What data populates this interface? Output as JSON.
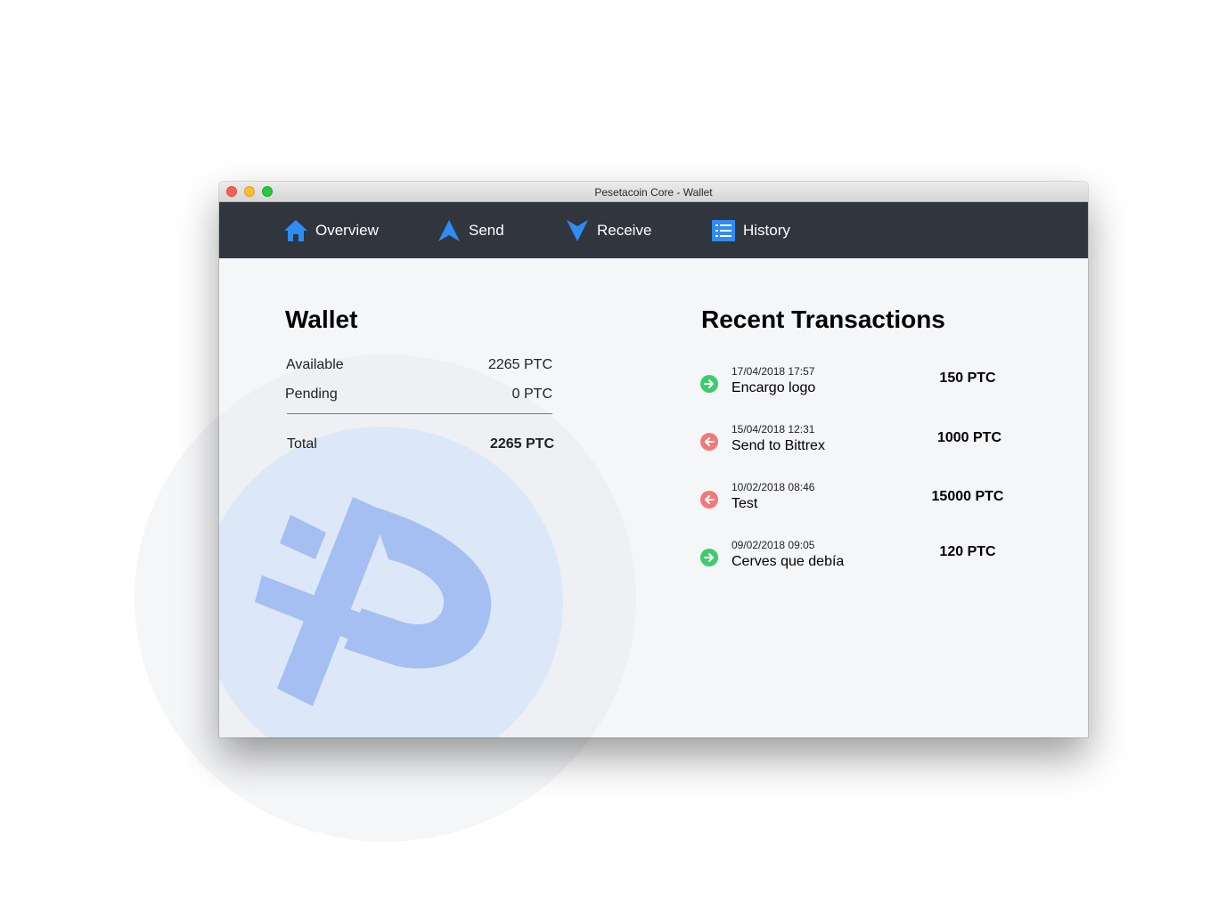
{
  "window": {
    "title": "Pesetacoin Core - Wallet"
  },
  "nav": {
    "items": [
      {
        "label": "Overview",
        "icon": "home-icon"
      },
      {
        "label": "Send",
        "icon": "send-arrow-icon"
      },
      {
        "label": "Receive",
        "icon": "receive-arrow-icon"
      },
      {
        "label": "History",
        "icon": "list-icon"
      }
    ],
    "accent_color": "#2f8cf5",
    "bar_color": "#30353e"
  },
  "wallet": {
    "title": "Wallet",
    "available_label": "Available",
    "available_value": "2265 PTC",
    "pending_label": "Pending",
    "pending_value": "0 PTC",
    "total_label": "Total",
    "total_value": "2265 PTC"
  },
  "transactions": {
    "title": "Recent Transactions",
    "items": [
      {
        "date": "17/04/2018 17:57",
        "label": "Encargo logo",
        "amount": "150 PTC",
        "direction": "incoming",
        "color": "#3ecb6f"
      },
      {
        "date": "15/04/2018 12:31",
        "label": "Send to Bittrex",
        "amount": "1000 PTC",
        "direction": "outgoing",
        "color": "#f07a7a"
      },
      {
        "date": "10/02/2018 08:46",
        "label": "Test",
        "amount": "15000 PTC",
        "direction": "outgoing",
        "color": "#f07a7a"
      },
      {
        "date": "09/02/2018 09:05",
        "label": "Cerves que debía",
        "amount": "120 PTC",
        "direction": "incoming",
        "color": "#3ecb6f"
      }
    ]
  }
}
